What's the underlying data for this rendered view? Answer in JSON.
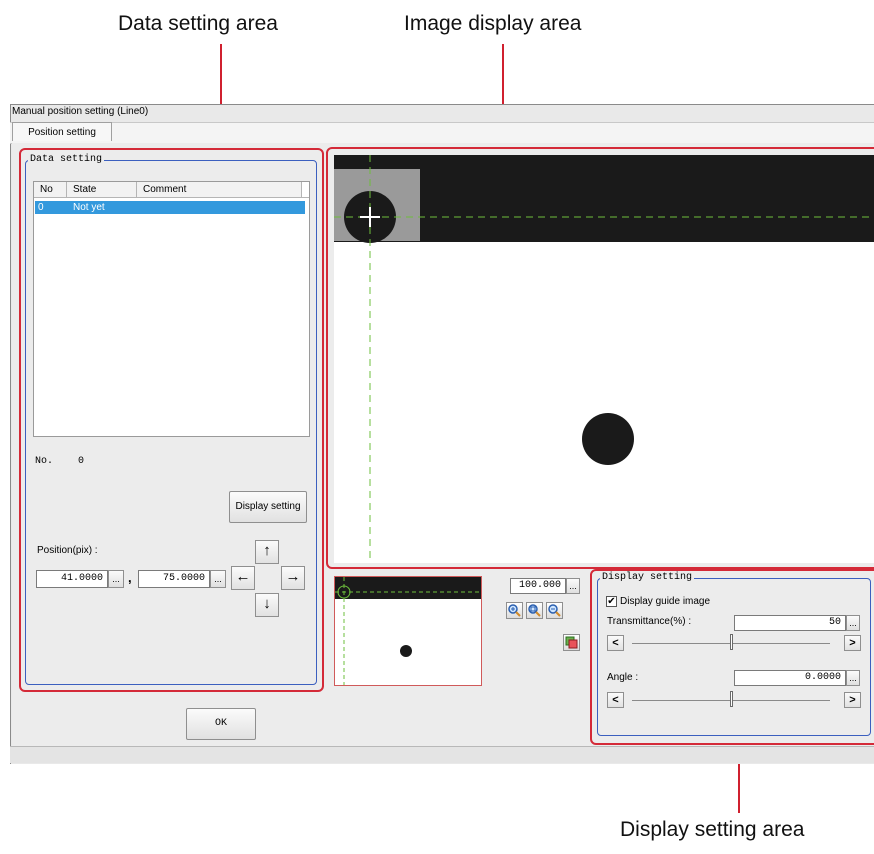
{
  "callouts": {
    "data_setting_area": "Data setting area",
    "image_display_area": "Image display area",
    "display_setting_area": "Display setting area"
  },
  "window": {
    "title": "Manual position setting (Line0)",
    "tab": "Position setting"
  },
  "data_setting": {
    "group_title": "Data setting",
    "columns": [
      "No",
      "State",
      "Comment"
    ],
    "rows": [
      {
        "no": "0",
        "state": "Not yet",
        "comment": ""
      }
    ],
    "no_label": "No.",
    "no_value": "0",
    "display_setting_button": "Display setting",
    "position_label": "Position(pix) :",
    "position_x": "41.0000",
    "position_y": "75.0000",
    "separator": ",",
    "dots": "...",
    "arrows": {
      "up": "↑",
      "down": "↓",
      "left": "←",
      "right": "→"
    }
  },
  "image_display": {
    "zoom_value": "100.000",
    "zoom_in": "zoom-in-icon",
    "zoom_fit": "zoom-fit-icon",
    "zoom_out": "zoom-out-icon",
    "image_switch": "image-switch-icon"
  },
  "display_setting": {
    "group_title": "Display setting",
    "guide_checkbox_label": "Display guide image",
    "guide_checked": true,
    "check_mark": "✔",
    "transmittance_label": "Transmittance(%) :",
    "transmittance_value": "50",
    "transmittance_level": 0.5,
    "angle_label": "Angle :",
    "angle_value": "0.0000",
    "angle_level": 0.5,
    "dec": "<",
    "inc": ">"
  },
  "ok_button": "OK",
  "colors": {
    "callout_red": "#d42a38",
    "group_blue": "#3b5fbf",
    "selection": "#3399dd",
    "guide_green": "#6dbf3c"
  }
}
